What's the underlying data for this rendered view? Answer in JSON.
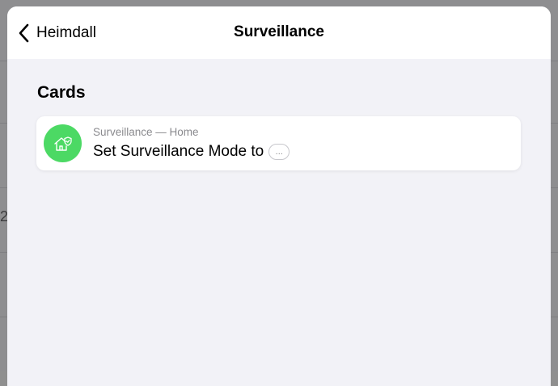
{
  "navbar": {
    "back_label": "Heimdall",
    "title": "Surveillance"
  },
  "section": {
    "title": "Cards"
  },
  "cards": [
    {
      "subtitle": "Surveillance — Home",
      "text": "Set Surveillance Mode to",
      "param_placeholder": "...",
      "icon": "home-shield-icon",
      "icon_color": "#4cd964"
    }
  ],
  "background": {
    "partial_glyph": "2"
  },
  "colors": {
    "accent_green": "#4cd964",
    "sheet_background": "#f2f2f7",
    "secondary_text": "#8a8a8e"
  }
}
